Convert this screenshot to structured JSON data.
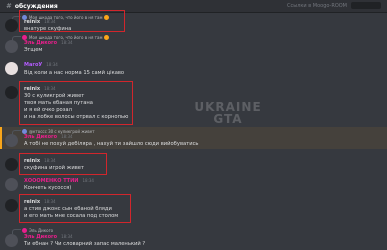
{
  "top": {
    "channel": "обсуждения",
    "right_text": "Ссылки в Moogo-ROOM"
  },
  "colors": {
    "redbox": "#d1262c",
    "pink": "#e91e8c",
    "purple": "#b45cff",
    "green": "#43b581"
  },
  "messages": [
    {
      "reply": "Моя шкода того, что його в ня там",
      "user": "reinix",
      "time": "18:34",
      "user_color": "#dcddde",
      "lines": [
        "внатуре скуфина"
      ]
    },
    {
      "reply": "Моя шкода того, что його в ня там",
      "user": "Эль Дикого",
      "time": "18:34",
      "user_color": "#e91e8c",
      "lines": [
        "Эгщем"
      ]
    },
    {
      "user": "МагоУ",
      "time": "18:34",
      "user_color": "#b45cff",
      "lines": [
        "Від коли а нас норма 15 самй цікаво"
      ]
    },
    {
      "user": "reinix",
      "time": "18:34",
      "user_color": "#dcddde",
      "lines": [
        "30 с куликгрой живет",
        "твоя мать ебаная путана",
        "и я ей очко розал",
        "и на лобке волосы отрвал с корнопью"
      ]
    },
    {
      "reply": "@ктоссс 30 с куликгрой живет",
      "user": "Эль Дикого",
      "time": "18:34",
      "user_color": "#e91e8c",
      "lines": [
        "А тобі не похуй дебіляра , нахуй ти зайшло сюди вийобуватись"
      ]
    },
    {
      "user": "reinix",
      "time": "18:34",
      "user_color": "#dcddde",
      "lines": [
        "скуфина игрой живет"
      ]
    },
    {
      "user": "ХОООМЕНКО ТТИИ",
      "time": "18:34",
      "user_color": "#e91e8c",
      "lines": [
        "Кончеть кусосся)"
      ]
    },
    {
      "user": "reinix",
      "time": "18:34",
      "user_color": "#dcddde",
      "lines": [
        "а стив джонс сын ебаной бляди",
        "и его мать мне сосала под столом"
      ]
    },
    {
      "reply": "Эль Дикого",
      "user": "Эль Дикого",
      "time": "18:34",
      "user_color": "#e91e8c",
      "lines": [
        "Ти ебнан ? Чи словарний запас маленький ?"
      ]
    }
  ],
  "watermark": {
    "line1": "UKRAINE",
    "line2": "GTA"
  }
}
